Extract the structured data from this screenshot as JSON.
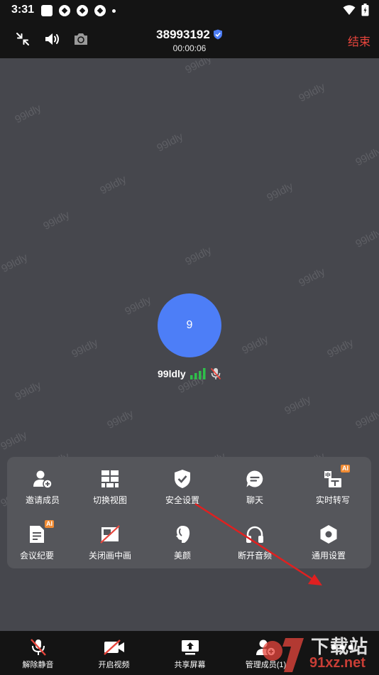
{
  "status_bar": {
    "time": "3:31"
  },
  "top_bar": {
    "meeting_id": "38993192",
    "timer": "00:00:06",
    "end_label": "结束"
  },
  "participant": {
    "avatar_text": "9",
    "name": "99ldly"
  },
  "watermark": "99ldly",
  "more_panel": {
    "items": [
      {
        "label": "邀请成员",
        "icon": "add-person-icon"
      },
      {
        "label": "切换视图",
        "icon": "grid-view-icon"
      },
      {
        "label": "安全设置",
        "icon": "shield-check-icon"
      },
      {
        "label": "聊天",
        "icon": "chat-bubble-icon"
      },
      {
        "label": "实时转写",
        "icon": "transcribe-icon",
        "badge": "AI"
      },
      {
        "label": "会议纪要",
        "icon": "minutes-icon",
        "badge": "AI"
      },
      {
        "label": "关闭画中画",
        "icon": "pip-off-icon"
      },
      {
        "label": "美颜",
        "icon": "beauty-icon"
      },
      {
        "label": "断开音频",
        "icon": "headphones-icon"
      },
      {
        "label": "通用设置",
        "icon": "settings-icon"
      }
    ]
  },
  "bottom_bar": {
    "items": [
      {
        "label": "解除静音",
        "icon": "mic-muted-icon"
      },
      {
        "label": "开启视频",
        "icon": "camera-off-icon"
      },
      {
        "label": "共享屏幕",
        "icon": "share-screen-icon"
      },
      {
        "label": "管理成员(1)",
        "icon": "manage-members-icon"
      }
    ]
  },
  "logo": {
    "text": "下载站",
    "url": "91xz.net"
  },
  "colors": {
    "accent_blue": "#4d7ef7",
    "end_red": "#e8453c",
    "signal_green": "#2fbf4a",
    "ai_orange": "#f08b33",
    "arrow_red": "#e02020"
  }
}
